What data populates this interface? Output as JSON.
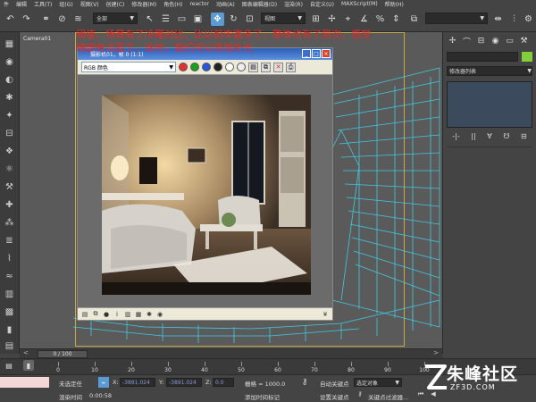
{
  "menu": [
    "件",
    "编辑",
    "工具(T)",
    "组(G)",
    "视图(V)",
    "创建(C)",
    "修改器(M)",
    "角色(H)",
    "reactor",
    "动画(A)",
    "图表编辑器(D)",
    "渲染(R)",
    "自定义(U)",
    "MAXScript(M)",
    "帮助(H)"
  ],
  "toolbar": {
    "selection_filter": "全部",
    "reference_coord": "视图",
    "selection_set": ""
  },
  "viewport": {
    "label": "Camera01",
    "annotation": "阈值，场景有了冷暖对比，比以前丰富多了，整体也有了层次，感觉暗部有点蓝了，这时，我们可以添加补光",
    "frame_color": "#c9a646",
    "wire_color": "#3fd6f2"
  },
  "render_window": {
    "title": "摄影机01，帧 0 (1:1)",
    "channel_select": "RGB 颜色",
    "channels": [
      "#e53030",
      "#1aa01a",
      "#2a55d8"
    ],
    "status_icons": [
      "save-icon",
      "clone-icon",
      "close-icon",
      "print-icon"
    ]
  },
  "command_panel": {
    "modifier_list": "修改器列表",
    "object_color": "#7fce3a",
    "tools": [
      "-|-",
      "||",
      "∀",
      "☋",
      "⊟"
    ]
  },
  "timeline": {
    "current": "0 / 100",
    "ticks": [
      "0",
      "10",
      "20",
      "30",
      "40",
      "50",
      "60",
      "70",
      "80",
      "90",
      "100"
    ]
  },
  "statusbar": {
    "selection_status": "未选定任",
    "x_label": "X:",
    "x_value": "-3891.024",
    "y_label": "Y:",
    "y_value": "-3891.024",
    "z_label": "Z:",
    "z_value": "0.0",
    "grid": "栅格 = 1000.0",
    "auto_key": "自动关键点",
    "key_mode": "选定对象",
    "set_key": "设置关键点",
    "key_filters": "关键点过滤器...",
    "render_time": "渲染时间",
    "render_time_value": "0:00:58",
    "add_time_tag": "添加时间标记"
  },
  "watermark": {
    "name": "朱峰社区",
    "url": "ZF3D.COM"
  }
}
